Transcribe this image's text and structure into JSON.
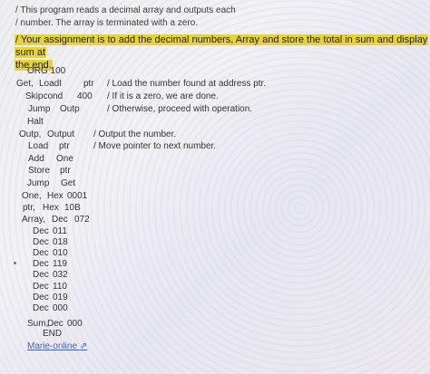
{
  "intro": {
    "line1": "/ This program reads a decimal array and outputs each",
    "line2": "/ number. The array is terminated with a zero."
  },
  "assignment": {
    "line1": "/ Your assignment is to add the decimal numbers, Array and store the total in sum and display sum at",
    "line2": "the end."
  },
  "code": {
    "org": "ORG 100",
    "get": "Get,",
    "loadi": "LoadI",
    "ptr1": "ptr",
    "c_load": "/ Load the number found at address ptr.",
    "skipcond": "Skipcond",
    "n400": "400",
    "c_zero": "/ If it is a zero, we are done.",
    "jump1": "Jump",
    "outp1": "Outp",
    "c_otherwise": "/ Otherwise, proceed with operation.",
    "halt": "Halt",
    "outp_label": "Outp,",
    "output": "Output",
    "c_output": "/ Output the number.",
    "load": "Load",
    "ptr2": "ptr",
    "c_move": "/ Move pointer to next number.",
    "add": "Add",
    "one": "One",
    "store": "Store",
    "ptr3": "ptr",
    "jump2": "Jump",
    "get2": "Get",
    "one_label": "One,",
    "hex1": "Hex",
    "v0001": "0001",
    "ptr_label": "ptr,",
    "hex2": "Hex",
    "v10b": "10B",
    "array_label": "Array,",
    "dec_a": "Dec",
    "v072": "072",
    "decs": [
      {
        "dec": "Dec",
        "val": "011"
      },
      {
        "dec": "Dec",
        "val": "018"
      },
      {
        "dec": "Dec",
        "val": "010"
      },
      {
        "dec": "Dec",
        "val": "119"
      },
      {
        "dec": "Dec",
        "val": "032"
      },
      {
        "dec": "Dec",
        "val": "110"
      },
      {
        "dec": "Dec",
        "val": "019"
      },
      {
        "dec": "Dec",
        "val": "000"
      }
    ],
    "sum_label": "Sum,",
    "sum_dec": "Dec",
    "sum_val": "000",
    "end": "END"
  },
  "link": {
    "label": "Marie-online ⇗"
  }
}
